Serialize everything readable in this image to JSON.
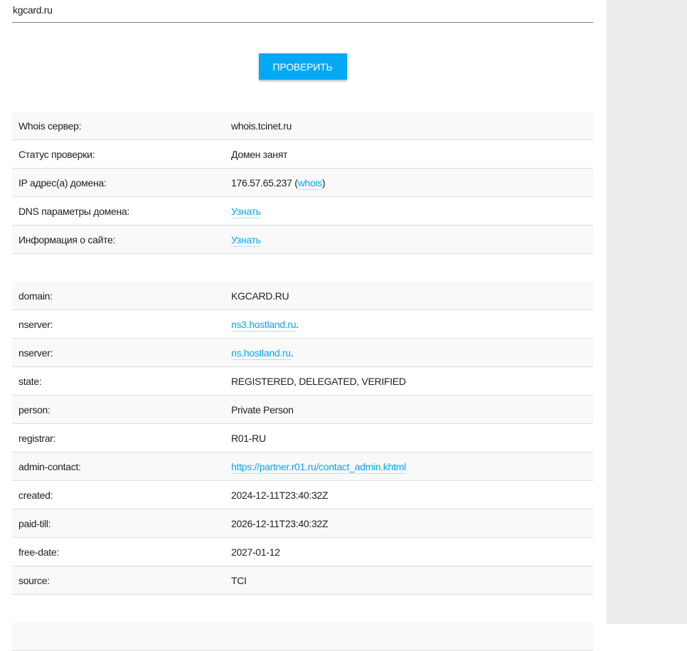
{
  "search": {
    "value": "kgcard.ru"
  },
  "check_button": "ПРОВЕРИТЬ",
  "summary": [
    {
      "label": "Whois сервер:",
      "parts": [
        {
          "text": "whois.tcinet.ru"
        }
      ]
    },
    {
      "label": "Статус проверки:",
      "parts": [
        {
          "text": "Домен занят"
        }
      ]
    },
    {
      "label": "IP адрес(а) домена:",
      "parts": [
        {
          "text": "176.57.65.237 ("
        },
        {
          "text": "whois",
          "link": true
        },
        {
          "text": ")"
        }
      ]
    },
    {
      "label": "DNS параметры домена:",
      "parts": [
        {
          "text": "Узнать",
          "link": true
        }
      ]
    },
    {
      "label": "Информация о сайте:",
      "parts": [
        {
          "text": "Узнать",
          "link": true
        }
      ]
    }
  ],
  "whois": [
    {
      "label": "domain:",
      "parts": [
        {
          "text": "KGCARD.RU"
        }
      ]
    },
    {
      "label": "nserver:",
      "parts": [
        {
          "text": "ns3.hostland.ru",
          "link": true
        },
        {
          "text": "."
        }
      ]
    },
    {
      "label": "nserver:",
      "parts": [
        {
          "text": "ns.hostland.ru",
          "link": true
        },
        {
          "text": "."
        }
      ]
    },
    {
      "label": "state:",
      "parts": [
        {
          "text": "REGISTERED, DELEGATED, VERIFIED"
        }
      ]
    },
    {
      "label": "person:",
      "parts": [
        {
          "text": "Private Person"
        }
      ]
    },
    {
      "label": "registrar:",
      "parts": [
        {
          "text": "R01-RU"
        }
      ]
    },
    {
      "label": "admin-contact:",
      "parts": [
        {
          "text": "https://partner.r01.ru/contact_admin.khtml",
          "link": true
        }
      ]
    },
    {
      "label": "created:",
      "parts": [
        {
          "text": "2024-12-11T23:40:32Z"
        }
      ]
    },
    {
      "label": "paid-till:",
      "parts": [
        {
          "text": "2026-12-11T23:40:32Z"
        }
      ]
    },
    {
      "label": "free-date:",
      "parts": [
        {
          "text": "2027-01-12"
        }
      ]
    },
    {
      "label": "source:",
      "parts": [
        {
          "text": "TCI"
        }
      ]
    }
  ],
  "colors": {
    "accent": "#03a9f4",
    "row_alt": "#f9f9f9",
    "sidebar": "#ececec"
  }
}
